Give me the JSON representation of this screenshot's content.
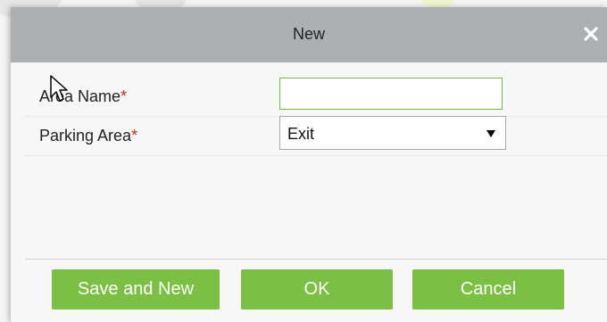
{
  "dialog": {
    "title": "New",
    "close_icon": "close-icon"
  },
  "form": {
    "area_name": {
      "label": "Area Name",
      "required_mark": "*",
      "value": "",
      "placeholder": ""
    },
    "parking_area": {
      "label": "Parking Area",
      "required_mark": "*",
      "selected": "Exit",
      "arrow_icon": "triangle-down-icon"
    }
  },
  "buttons": {
    "save_and_new": "Save and New",
    "ok": "OK",
    "cancel": "Cancel"
  },
  "colors": {
    "titlebar": "#adb0b3",
    "button_green": "#7bc043",
    "input_focus_border": "#7ab648",
    "required": "#e02020"
  }
}
